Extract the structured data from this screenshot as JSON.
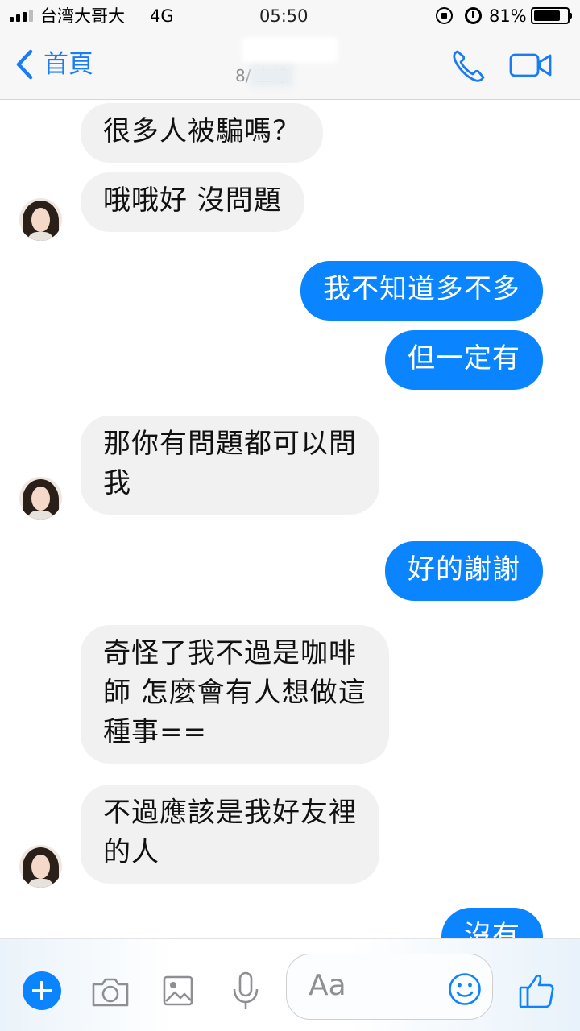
{
  "status_bar": {
    "carrier": "台湾大哥大",
    "network": "4G",
    "time": "05:50",
    "battery_percent": "81%",
    "battery_level": 0.81
  },
  "nav": {
    "back_label": "首頁",
    "active_status": "8/   上線",
    "accent_color": "#1a7cf4"
  },
  "messages": [
    {
      "side": "incoming",
      "text": "很多人被騙嗎？"
    },
    {
      "side": "incoming",
      "text": "哦哦好 沒問題"
    },
    {
      "side": "outgoing",
      "text": "我不知道多不多"
    },
    {
      "side": "outgoing",
      "text": "但一定有"
    },
    {
      "side": "incoming",
      "lines": [
        "那你有問題都可以問",
        "我"
      ]
    },
    {
      "side": "outgoing",
      "text": "好的謝謝"
    },
    {
      "side": "incoming",
      "lines": [
        "奇怪了我不過是咖啡",
        "師 怎麼會有人想做這",
        "種事=="
      ]
    },
    {
      "side": "incoming",
      "lines": [
        "不過應該是我好友裡",
        "的人"
      ]
    },
    {
      "side": "outgoing",
      "text": "沒有"
    }
  ],
  "composer": {
    "placeholder": "Aa",
    "icons": [
      "plus-icon",
      "camera-icon",
      "gallery-icon",
      "microphone-icon",
      "emoji-icon",
      "thumbs-up-icon"
    ]
  },
  "colors": {
    "outgoing_bubble": "#0a84ff",
    "incoming_bubble": "#f1f1f1"
  }
}
